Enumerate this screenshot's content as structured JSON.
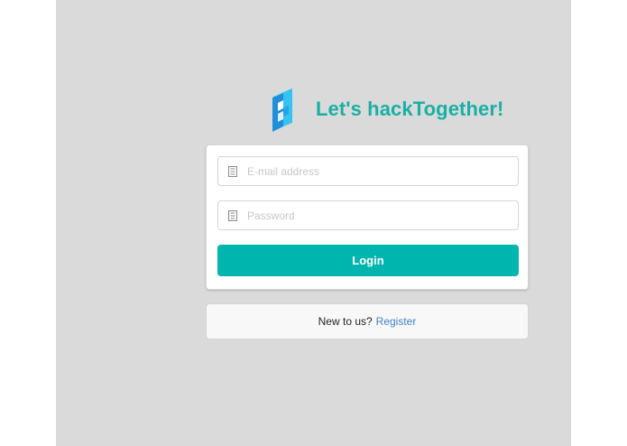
{
  "header": {
    "title": "Let's hackTogether!",
    "logo_icon": "hacktogether-logo-icon"
  },
  "login_form": {
    "email": {
      "placeholder": "E-mail address",
      "value": "",
      "icon": "id-card-icon"
    },
    "password": {
      "placeholder": "Password",
      "value": "",
      "icon": "lock-icon"
    },
    "login_label": "Login"
  },
  "register": {
    "prompt": "New to us?",
    "link_label": "Register"
  },
  "colors": {
    "accent": "#00b5ad",
    "title": "#1aafa5",
    "link": "#4183c4",
    "background": "#dadada"
  }
}
